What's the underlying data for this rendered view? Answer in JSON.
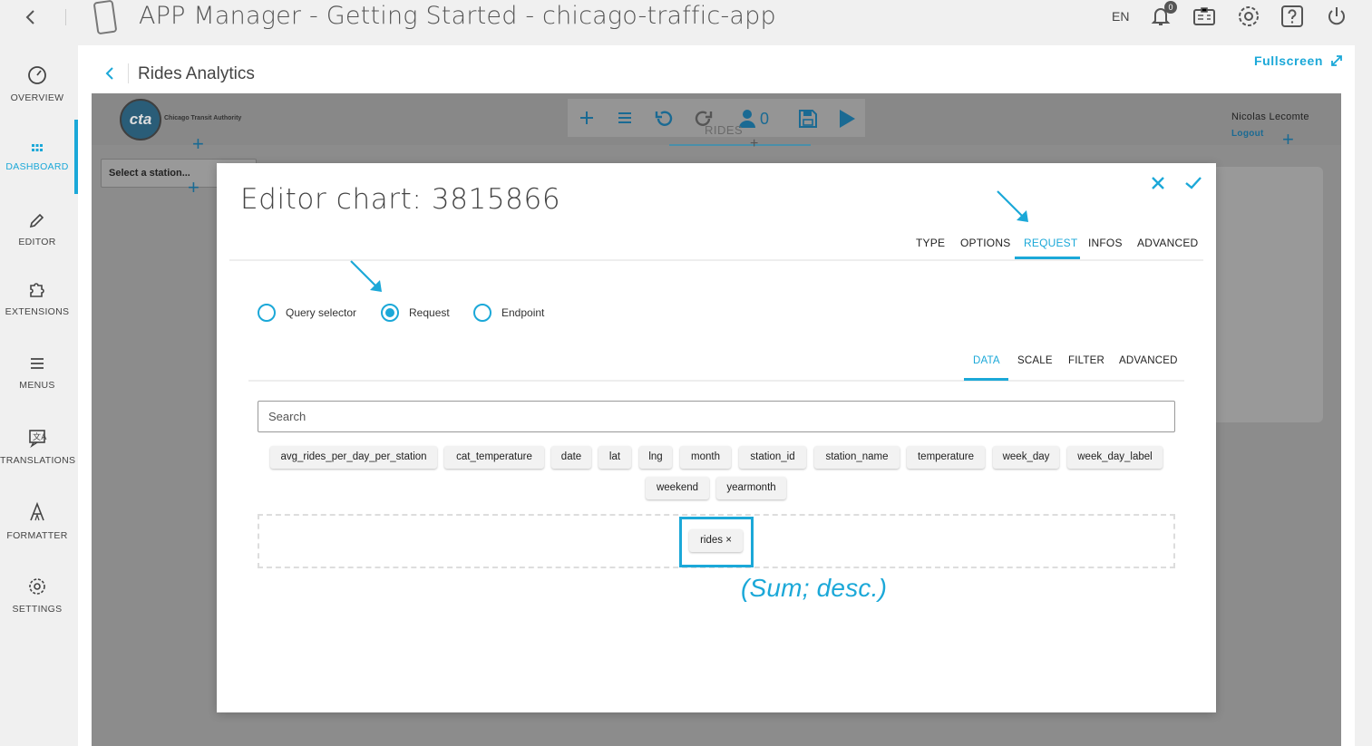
{
  "header": {
    "title": "APP Manager - Getting Started - chicago-traffic-app",
    "language": "EN",
    "notifications_count": "0"
  },
  "sidebar": {
    "items": [
      {
        "label": "OVERVIEW",
        "icon": "gauge-icon"
      },
      {
        "label": "DASHBOARD",
        "icon": "grid-icon",
        "active": true
      },
      {
        "label": "EDITOR",
        "icon": "pencil-icon"
      },
      {
        "label": "EXTENSIONS",
        "icon": "puzzle-icon"
      },
      {
        "label": "MENUS",
        "icon": "menu-icon"
      },
      {
        "label": "TRANSLATIONS",
        "icon": "translate-icon"
      },
      {
        "label": "FORMATTER",
        "icon": "formatter-icon"
      },
      {
        "label": "SETTINGS",
        "icon": "gear-icon"
      }
    ]
  },
  "page": {
    "title": "Rides Analytics",
    "fullscreen_label": "Fullscreen"
  },
  "dashboard": {
    "logo_text": "cta",
    "org_name": "Chicago Transit Authority",
    "user_count": "0",
    "tab_label": "RIDES",
    "user_name": "Nicolas Lecomte",
    "logout_label": "Logout",
    "station_placeholder": "Select a station..."
  },
  "modal": {
    "title": "Editor chart: 3815866",
    "tabs": [
      {
        "label": "TYPE"
      },
      {
        "label": "OPTIONS"
      },
      {
        "label": "REQUEST",
        "active": true
      },
      {
        "label": "INFOS"
      },
      {
        "label": "ADVANCED"
      }
    ],
    "radios": [
      {
        "label": "Query selector",
        "checked": false
      },
      {
        "label": "Request",
        "checked": true
      },
      {
        "label": "Endpoint",
        "checked": false
      }
    ],
    "subtabs": [
      {
        "label": "DATA",
        "active": true
      },
      {
        "label": "SCALE"
      },
      {
        "label": "FILTER"
      },
      {
        "label": "ADVANCED"
      }
    ],
    "search_placeholder": "Search",
    "fields": [
      "avg_rides_per_day_per_station",
      "cat_temperature",
      "date",
      "lat",
      "lng",
      "month",
      "station_id",
      "station_name",
      "temperature",
      "week_day",
      "week_day_label",
      "weekend",
      "yearmonth"
    ],
    "selected_field": "rides ×",
    "annotation": "(Sum; desc.)"
  },
  "colors": {
    "accent": "#1ba8d8",
    "overlay": "#8c8c8c"
  }
}
